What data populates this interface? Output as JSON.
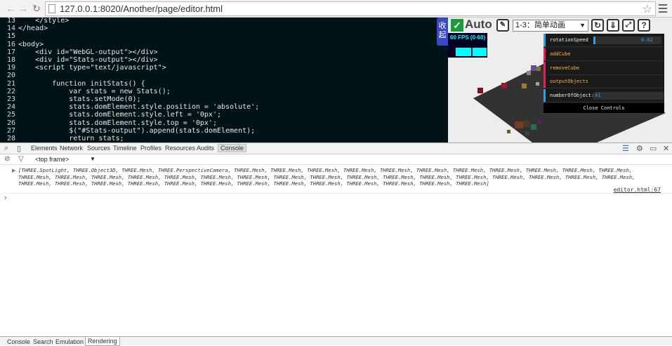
{
  "browser": {
    "url": "127.0.0.1:8020/Another/page/editor.html"
  },
  "editor": {
    "lines": [
      {
        "n": "13",
        "text": "    </style>"
      },
      {
        "n": "14",
        "text": "</head>"
      },
      {
        "n": "15",
        "text": ""
      },
      {
        "n": "16",
        "text": "<body>"
      },
      {
        "n": "17",
        "text": "    <div id=\"WebGL-output\"></div>"
      },
      {
        "n": "18",
        "text": "    <div id=\"Stats-output\"></div>"
      },
      {
        "n": "19",
        "text": "    <script type=\"text/javascript\">"
      },
      {
        "n": "20",
        "text": ""
      },
      {
        "n": "21",
        "text": "        function initStats() {"
      },
      {
        "n": "22",
        "text": "            var stats = new Stats();"
      },
      {
        "n": "23",
        "text": "            stats.setMode(0);"
      },
      {
        "n": "24",
        "text": "            stats.domElement.style.position = 'absolute';"
      },
      {
        "n": "25",
        "text": "            stats.domElement.style.left = '0px';"
      },
      {
        "n": "26",
        "text": "            stats.domElement.style.top = '0px';"
      },
      {
        "n": "27",
        "text": "            $(\"#Stats-output\").append(stats.domElement);"
      },
      {
        "n": "28",
        "text": "            return stats;"
      }
    ]
  },
  "preview": {
    "collapse_label": "收起",
    "auto_label": "Auto",
    "example_select": "1-3：简单动画",
    "stats_text": "60 FPS (0-60)",
    "gui": {
      "rows": [
        {
          "label": "rotationSpeed",
          "value": "0.02",
          "kind": "slider",
          "fraction": 0.02
        },
        {
          "label": "addCube",
          "kind": "function"
        },
        {
          "label": "removeCube",
          "kind": "function"
        },
        {
          "label": "outputObjects",
          "kind": "function"
        },
        {
          "label": "numberOfObject:",
          "value": "41",
          "kind": "number"
        }
      ],
      "close_label": "Close Controls"
    }
  },
  "devtools": {
    "tabs": [
      "Elements",
      "Network",
      "Sources",
      "Timeline",
      "Profiles",
      "Resources",
      "Audits",
      "Console"
    ],
    "active_tab": "Console",
    "frame_select": "<top frame>",
    "log_text": "[THREE.SpotLight, THREE.Object3D, THREE.Mesh, THREE.PerspectiveCamera, THREE.Mesh, THREE.Mesh, THREE.Mesh, THREE.Mesh, THREE.Mesh, THREE.Mesh, THREE.Mesh, THREE.Mesh, THREE.Mesh, THREE.Mesh, THREE.Mesh, THREE.Mesh, THREE.Mesh, THREE.Mesh, THREE.Mesh, THREE.Mesh, THREE.Mesh, THREE.Mesh, THREE.Mesh, THREE.Mesh, THREE.Mesh, THREE.Mesh, THREE.Mesh, THREE.Mesh, THREE.Mesh, THREE.Mesh, THREE.Mesh, THREE.Mesh, THREE.Mesh, THREE.Mesh, THREE.Mesh, THREE.Mesh, THREE.Mesh, THREE.Mesh, THREE.Mesh, THREE.Mesh, THREE.Mesh, THREE.Mesh, THREE.Mesh, THREE.Mesh, THREE.Mesh]",
    "log_source": "editor.html:67",
    "prompt_symbol": "›",
    "drawer_tabs": [
      "Console",
      "Search",
      "Emulation",
      "Rendering"
    ],
    "drawer_active": "Rendering"
  }
}
